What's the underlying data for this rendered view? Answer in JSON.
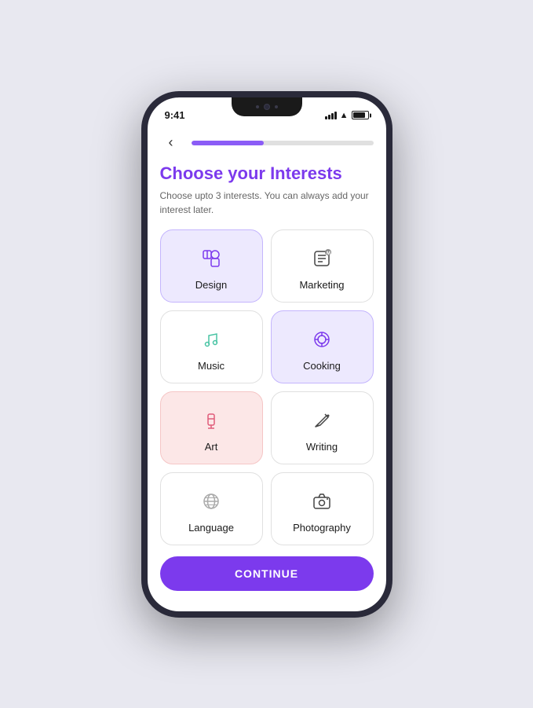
{
  "status": {
    "time": "9:41",
    "signal": true,
    "wifi": true,
    "battery": true
  },
  "nav": {
    "back_label": "‹",
    "progress_percent": 40
  },
  "header": {
    "title": "Choose your Interests",
    "subtitle": "Choose upto 3 interests. You can always add your interest later."
  },
  "interests": [
    {
      "id": "design",
      "label": "Design",
      "icon": "✂️",
      "state": "selected-purple"
    },
    {
      "id": "marketing",
      "label": "Marketing",
      "icon": "📋",
      "state": "normal"
    },
    {
      "id": "music",
      "label": "Music",
      "icon": "🎵",
      "state": "normal"
    },
    {
      "id": "cooking",
      "label": "Cooking",
      "icon": "©",
      "state": "selected-purple"
    },
    {
      "id": "art",
      "label": "Art",
      "icon": "✏️",
      "state": "selected-pink"
    },
    {
      "id": "writing",
      "label": "Writing",
      "icon": "✨",
      "state": "normal"
    },
    {
      "id": "language",
      "label": "Language",
      "icon": "🌐",
      "state": "normal"
    },
    {
      "id": "photography",
      "label": "Photography",
      "icon": "📷",
      "state": "normal"
    }
  ],
  "button": {
    "continue_label": "CONTINUE"
  }
}
